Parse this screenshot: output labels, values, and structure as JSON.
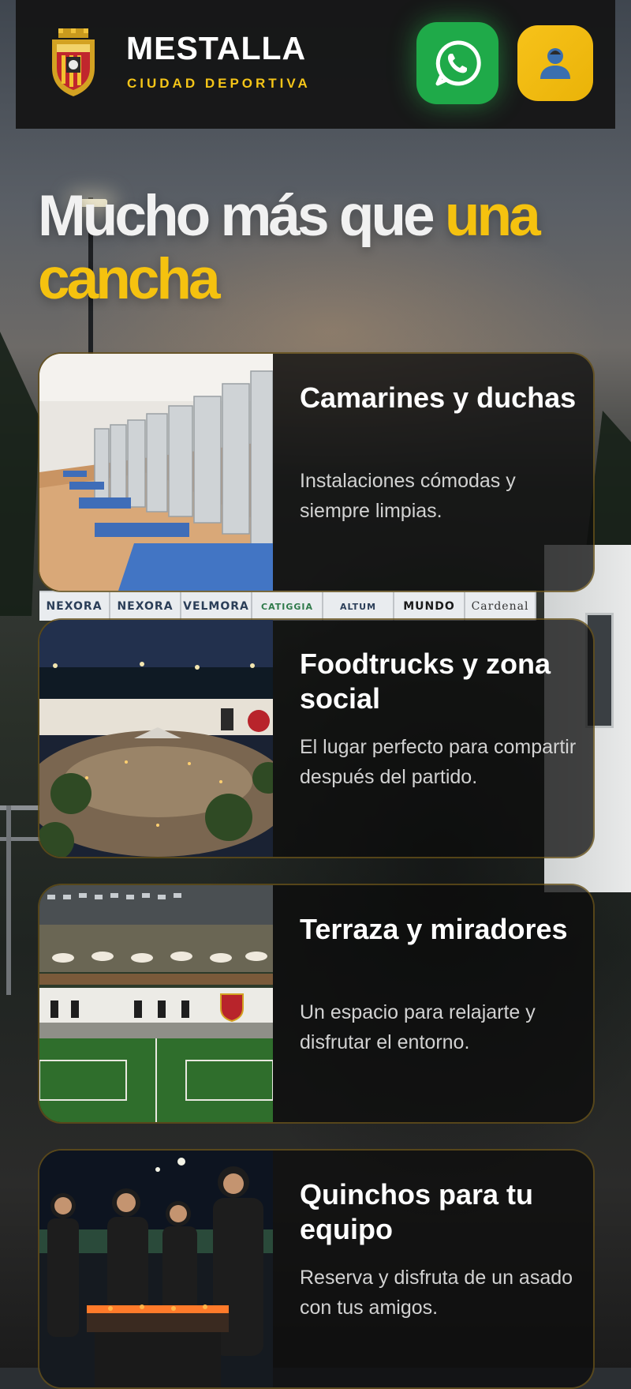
{
  "header": {
    "title": "MESTALLA",
    "subtitle": "CIUDAD DEPORTIVA",
    "whatsapp_icon": "whatsapp-icon",
    "account_icon": "user-icon"
  },
  "hero": {
    "text_white": "Mucho más que ",
    "text_yellow": "una cancha"
  },
  "colors": {
    "accent": "#f5c20f",
    "whatsapp": "#1faa49",
    "header_bg": "#141414"
  },
  "sponsors": [
    "NEXORA",
    "NEXORA",
    "VELMORA",
    "CATIGGIA",
    "ALTUM",
    "MUNDO",
    "Cardenal"
  ],
  "cards": [
    {
      "title": "Camarines y duchas",
      "desc": "Instalaciones cómodas y siempre limpias.",
      "image": "locker-room-photo"
    },
    {
      "title": "Foodtrucks y zona social",
      "desc": "El lugar perfecto para compartir después del partido.",
      "image": "social-area-photo"
    },
    {
      "title": "Terraza y miradores",
      "desc": "Un espacio para relajarte y disfrutar el entorno.",
      "image": "terrace-aerial-photo"
    },
    {
      "title": "Quinchos para tu equipo",
      "desc": "Reserva y disfruta de un asado con tus amigos.",
      "image": "barbecue-photo"
    }
  ]
}
